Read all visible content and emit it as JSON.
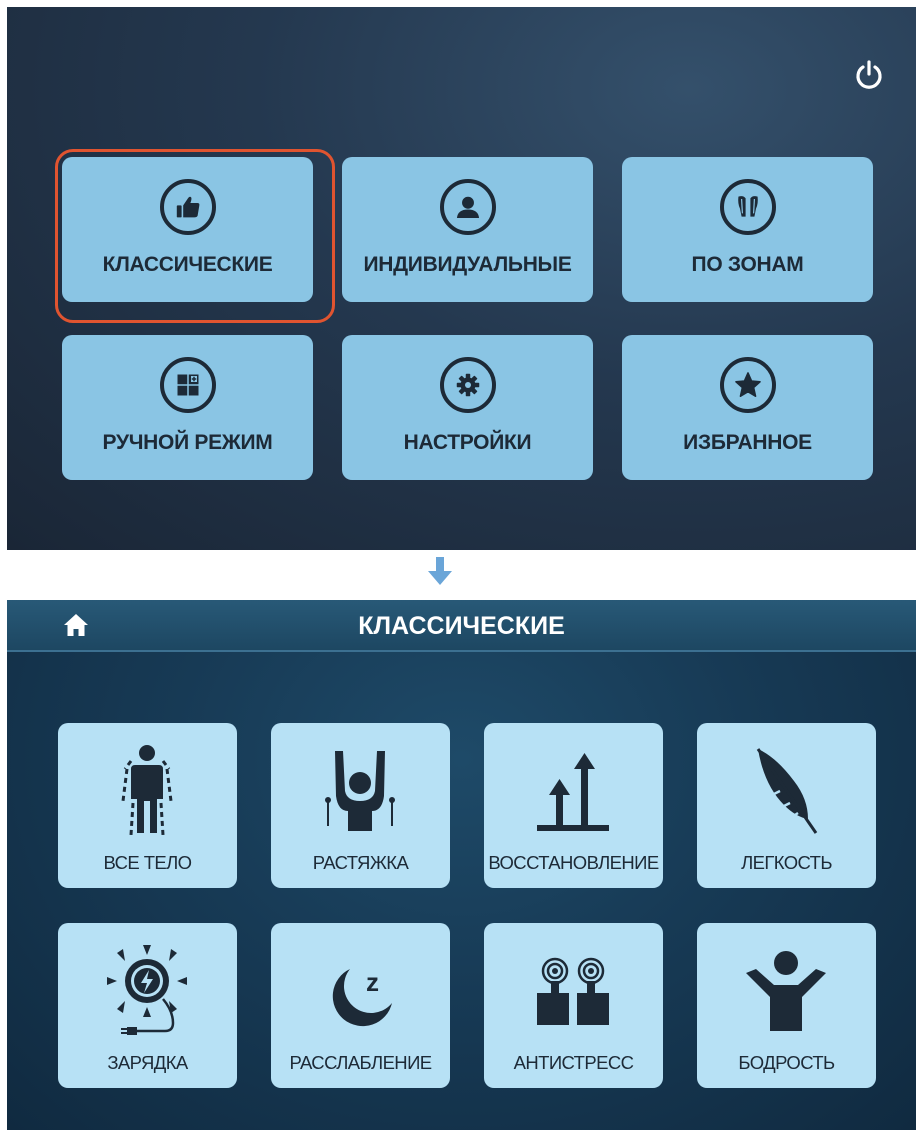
{
  "main_menu": {
    "items": [
      {
        "label": "КЛАССИЧЕСКИЕ",
        "icon": "thumbs-up-icon",
        "selected": true
      },
      {
        "label": "ИНДИВИДУАЛЬНЫЕ",
        "icon": "person-icon"
      },
      {
        "label": "ПО ЗОНАМ",
        "icon": "body-zones-icon"
      },
      {
        "label": "РУЧНОЙ РЕЖИМ",
        "icon": "manual-grid-icon"
      },
      {
        "label": "НАСТРОЙКИ",
        "icon": "gear-icon"
      },
      {
        "label": "ИЗБРАННОЕ",
        "icon": "star-icon"
      }
    ],
    "highlight_color": "#e05430"
  },
  "classic_screen": {
    "title": "КЛАССИЧЕСКИЕ",
    "programs": [
      {
        "label": "ВСЕ ТЕЛО",
        "icon": "full-body-icon"
      },
      {
        "label": "РАСТЯЖКА",
        "icon": "stretch-icon"
      },
      {
        "label": "ВОССТАНОВЛЕНИЕ",
        "icon": "recovery-arrows-icon"
      },
      {
        "label": "ЛЕГКОСТЬ",
        "icon": "feather-icon"
      },
      {
        "label": "ЗАРЯДКА",
        "icon": "charging-sun-icon"
      },
      {
        "label": "РАССЛАБЛЕНИЕ",
        "icon": "moon-sleep-icon"
      },
      {
        "label": "АНТИСТРЕСС",
        "icon": "antistress-icon"
      },
      {
        "label": "БОДРОСТЬ",
        "icon": "cheerful-person-icon"
      }
    ]
  },
  "colors": {
    "button_bg": "#8ac5e4",
    "tile_bg": "#b7e1f5",
    "icon_dark": "#1d2a37"
  }
}
